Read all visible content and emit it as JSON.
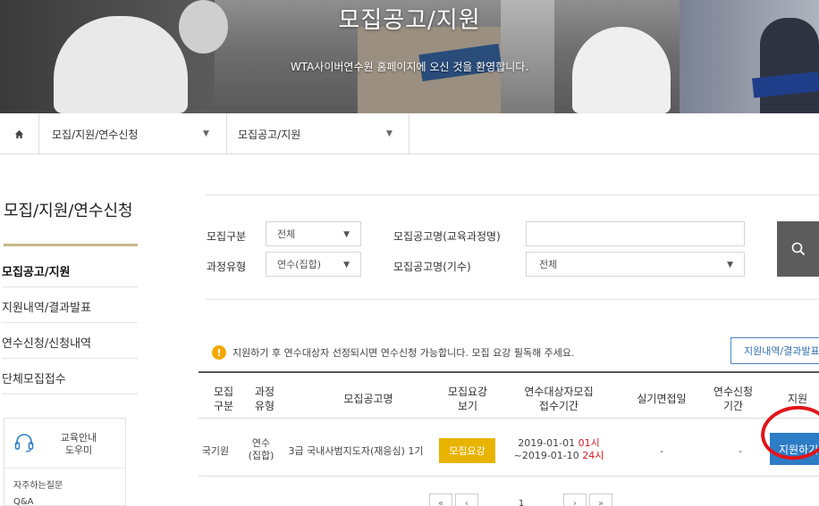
{
  "hero": {
    "title": "모집공고/지원",
    "subtitle": "WTA사이버연수원 홈페이지에 오신 것을 환영합니다."
  },
  "breadcrumb": {
    "level1": "모집/지원/연수신청",
    "level2": "모집공고/지원"
  },
  "sidebar": {
    "title": "모집/지원/연수신청",
    "items": [
      {
        "label": "모집공고/지원",
        "active": true
      },
      {
        "label": "지원내역/결과발표",
        "active": false
      },
      {
        "label": "연수신청/신청내역",
        "active": false
      },
      {
        "label": "단체모집접수",
        "active": false
      }
    ],
    "help": {
      "label_line1": "교육안내",
      "label_line2": "도우미",
      "links": [
        "자주하는질문",
        "Q&A"
      ]
    }
  },
  "search": {
    "category_label": "모집구분",
    "category_value": "전체",
    "type_label": "과정유형",
    "type_value": "연수(집합)",
    "name_label": "모집공고명(교육과정명)",
    "name_value": "",
    "round_label": "모집공고명(기수)",
    "round_value": "전체"
  },
  "notice": {
    "icon": "!",
    "text": "지원하기 후 연수대상자 선정되시면 연수신청 가능합니다. 모집 요강 필독해 주세요.",
    "result_button": "지원내역/결과발표"
  },
  "table": {
    "headers": {
      "category_1": "모집",
      "category_2": "구분",
      "type_1": "과정",
      "type_2": "유형",
      "name": "모집공고명",
      "guide_1": "모집요강",
      "guide_2": "보기",
      "period_1": "연수대상자모집",
      "period_2": "접수기간",
      "exam": "실기면접일",
      "apply_period_1": "연수신청",
      "apply_period_2": "기간",
      "apply": "지원"
    },
    "row": {
      "category": "국기원",
      "type_1": "연수",
      "type_2": "(집합)",
      "name": "3급 국내사범지도자(재응심) 1기",
      "guide_button": "모집요강",
      "start_date": "2019-01-01",
      "start_time": "01시",
      "end_date": "~2019-01-10",
      "end_time": "24시",
      "exam": "-",
      "apply_period": "-",
      "apply_button": "지원하기"
    }
  },
  "pagination": {
    "first": "«",
    "prev": "‹",
    "current": "1",
    "next": "›",
    "last": "»"
  },
  "colors": {
    "apply_button": "#2d7cc6",
    "guide_button": "#e8b400",
    "highlight_circle": "#e0151b",
    "time_highlight": "#d71920"
  }
}
